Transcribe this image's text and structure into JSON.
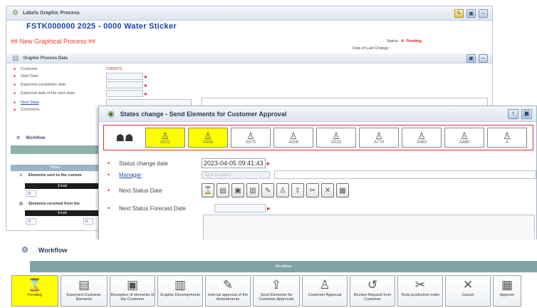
{
  "back_window": {
    "title": "Labels Graphic Process",
    "code": "FSTK000000  2025 - 0000 Water Sticker",
    "subtitle": "## New Graphical Process ##",
    "status_label": "Status :",
    "status_code": "A",
    "status_value": "Pending",
    "last_change_label": "Date of Last Change :",
    "section_title": "Graphic Process Data",
    "fields": [
      {
        "label": "Customer",
        "value": "C000073"
      },
      {
        "label": "Start Date",
        "value": ""
      },
      {
        "label": "Expected completion date",
        "value": ""
      },
      {
        "label": "Expected date of the next state",
        "value": ""
      },
      {
        "label": "Next State",
        "value": ""
      },
      {
        "label": "Comments",
        "value": ""
      }
    ],
    "workflow_label": "Workflow",
    "notes_header": "Notes",
    "sent_title": "Elements sent to the custom",
    "sent_col": "Email",
    "sent_value": "0",
    "recv_title": "Elements received from the",
    "recv_col": "Email",
    "recv_value_1": "0",
    "recv_value_2": "0"
  },
  "dialog": {
    "title": "States change - Send Elements for Customer Approval",
    "status_change_date_label": "Status change date",
    "status_change_date_value": "2023-04-05 09:41:43",
    "manager_label": "Manager",
    "manager_placeholder": "Type to select",
    "next_status_date_label": "Next Status Date",
    "next_status_forecast_label": "Next Status Forecast Date",
    "status_buttons": [
      "A001",
      "A005",
      "A075",
      "A006",
      "A025",
      "A774",
      "A483",
      "A489",
      "A"
    ]
  },
  "workflow_panel": {
    "title": "Workflow",
    "bar_label": "Workflow",
    "buttons": [
      {
        "label": "Pending",
        "icon": "hourglass-icon",
        "glyph": "⌛",
        "active": true
      },
      {
        "label": "Expected Customer Elements",
        "icon": "document-icon",
        "glyph": "▤"
      },
      {
        "label": "Reception of elements of the Customer",
        "icon": "monitor-icon",
        "glyph": "▣"
      },
      {
        "label": "Graphic Developments",
        "icon": "books-icon",
        "glyph": "▥"
      },
      {
        "label": "Internal approval of the Amendments",
        "icon": "approval-icon",
        "glyph": "✎"
      },
      {
        "label": "Send Elements for Customer Approvals",
        "icon": "send-icon",
        "glyph": "⇪"
      },
      {
        "label": "Customer Approval",
        "icon": "person-icon",
        "glyph": "♙"
      },
      {
        "label": "Review Request from Customer",
        "icon": "review-icon",
        "glyph": "↺"
      },
      {
        "label": "Tools production order",
        "icon": "tools-icon",
        "glyph": "✂"
      },
      {
        "label": "Cancel",
        "icon": "cancel-icon",
        "glyph": "✕"
      },
      {
        "label": "Approve",
        "icon": "approve-icon",
        "glyph": "▦"
      }
    ]
  }
}
